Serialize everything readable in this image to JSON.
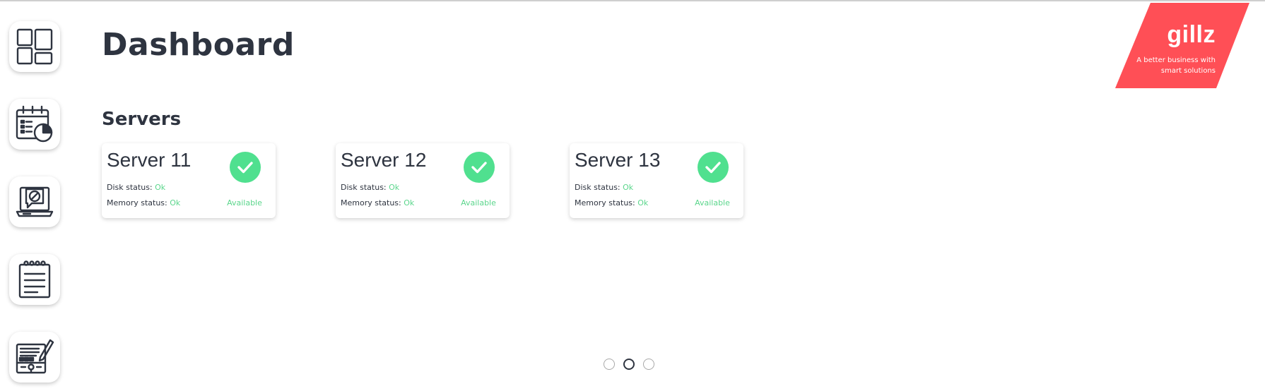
{
  "page": {
    "title": "Dashboard"
  },
  "sidebar": {
    "items": [
      {
        "name": "dashboard",
        "icon": "dashboard-icon"
      },
      {
        "name": "calendar",
        "icon": "calendar-clock-icon"
      },
      {
        "name": "support",
        "icon": "laptop-chat-icon"
      },
      {
        "name": "notes",
        "icon": "notepad-icon"
      },
      {
        "name": "planning",
        "icon": "board-pencil-icon"
      }
    ]
  },
  "logo": {
    "name": "gillz",
    "tagline_line1": "A better business with",
    "tagline_line2": "smart solutions",
    "color": "#ff4f56"
  },
  "servers": {
    "title": "Servers",
    "disk_label": "Disk status:",
    "memory_label": "Memory status:",
    "items": [
      {
        "name": "Server 11",
        "disk": "Ok",
        "memory": "Ok",
        "status": "Available",
        "icon": "check-circle-icon"
      },
      {
        "name": "Server 12",
        "disk": "Ok",
        "memory": "Ok",
        "status": "Available",
        "icon": "check-circle-icon"
      },
      {
        "name": "Server 13",
        "disk": "Ok",
        "memory": "Ok",
        "status": "Available",
        "icon": "check-circle-icon"
      }
    ]
  },
  "pagination": {
    "pages": 3,
    "current": 2
  },
  "colors": {
    "text": "#2e3440",
    "success": "#50e08f",
    "brand": "#ff4f56"
  }
}
